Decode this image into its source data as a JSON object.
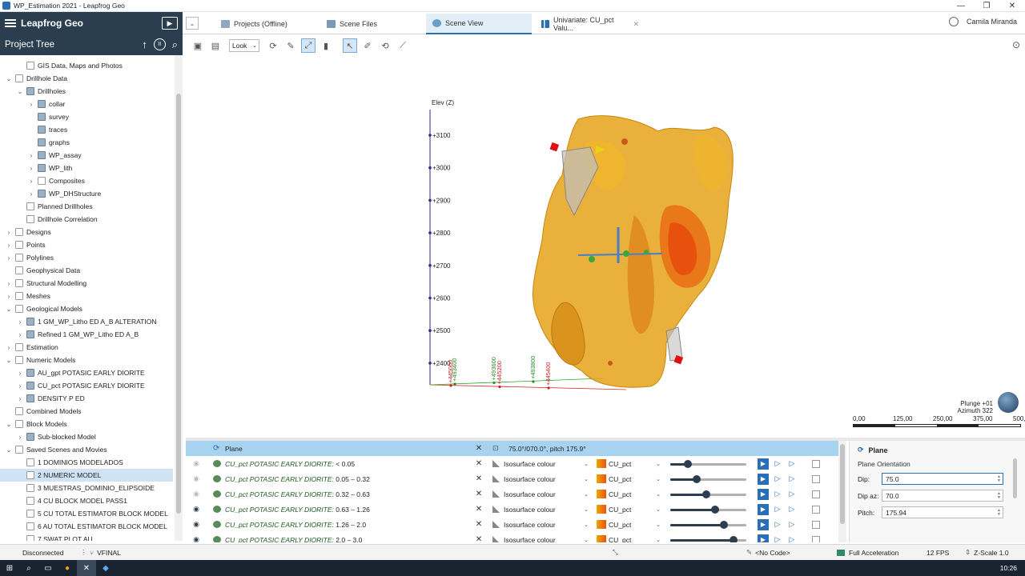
{
  "window": {
    "title": "WP_Estimation 2021 - Leapfrog Geo",
    "btn_min": "—",
    "btn_max": "❐",
    "btn_close": "✕"
  },
  "app": {
    "name": "Leapfrog Geo"
  },
  "tabs": [
    {
      "label": "Projects (Offline)"
    },
    {
      "label": "Scene Files"
    },
    {
      "label": "Scene View"
    },
    {
      "label": "Univariate: CU_pct Valu..."
    }
  ],
  "user": {
    "name": "Camila Miranda"
  },
  "project_tree": {
    "title": "Project Tree",
    "items": [
      {
        "label": "GIS Data, Maps and Photos"
      },
      {
        "label": "Drillhole Data"
      },
      {
        "label": "Drillholes"
      },
      {
        "label": "collar"
      },
      {
        "label": "survey"
      },
      {
        "label": "traces"
      },
      {
        "label": "graphs"
      },
      {
        "label": "WP_assay"
      },
      {
        "label": "WP_lith"
      },
      {
        "label": "Composites"
      },
      {
        "label": "WP_DHStructure"
      },
      {
        "label": "Planned Drillholes"
      },
      {
        "label": "Drillhole Correlation"
      },
      {
        "label": "Designs"
      },
      {
        "label": "Points"
      },
      {
        "label": "Polylines"
      },
      {
        "label": "Geophysical Data"
      },
      {
        "label": "Structural Modelling"
      },
      {
        "label": "Meshes"
      },
      {
        "label": "Geological Models"
      },
      {
        "label": "1 GM_WP_Litho ED A_B ALTERATION"
      },
      {
        "label": "Refined 1 GM_WP_Litho ED A_B"
      },
      {
        "label": "Estimation"
      },
      {
        "label": "Numeric Models"
      },
      {
        "label": "AU_gpt POTASIC EARLY DIORITE"
      },
      {
        "label": "CU_pct POTASIC EARLY DIORITE"
      },
      {
        "label": "DENSITY P ED"
      },
      {
        "label": "Combined Models"
      },
      {
        "label": "Block Models"
      },
      {
        "label": "Sub-blocked Model"
      },
      {
        "label": "Saved Scenes and Movies"
      },
      {
        "label": "1 DOMINIOS MODELADOS"
      },
      {
        "label": "2 NUMERIC MODEL"
      },
      {
        "label": "3 MUESTRAS_DOMINIO_ELIPSOIDE"
      },
      {
        "label": "4 CU BLOCK MODEL PASS1"
      },
      {
        "label": "5 CU TOTAL ESTIMATOR BLOCK MODEL"
      },
      {
        "label": "6 AU TOTAL ESTIMATOR BLOCK MODEL"
      },
      {
        "label": "7 SWAT PLOT AU"
      }
    ]
  },
  "toolbar": {
    "look_label": "Look"
  },
  "scene": {
    "elev_label": "Elev (Z)",
    "elev_ticks": [
      "+3100",
      "+3000",
      "+2900",
      "+2800",
      "+2700",
      "+2600",
      "+2500",
      "+2400"
    ],
    "north_ticks": [
      "+493400",
      "+493600",
      "+493800"
    ],
    "east_ticks": [
      "+445000",
      "+445200",
      "+445400"
    ],
    "plunge": "Plunge +01",
    "azimuth": "Azimuth 322",
    "scale_labels": [
      "0,00",
      "125,00",
      "250,00",
      "375,00",
      "500,00"
    ]
  },
  "layers": {
    "header": {
      "name": "Plane",
      "value": "75.0°/070.0°, pitch 175.9°"
    },
    "rows": [
      {
        "name": "CU_pct POTASIC EARLY DIORITE:",
        "range": "< 0.05",
        "mode": "Isosurface colour",
        "attr": "CU_pct",
        "visible": false,
        "opacity": 0.2
      },
      {
        "name": "CU_pct POTASIC EARLY DIORITE:",
        "range": "0.05 – 0.32",
        "mode": "Isosurface colour",
        "attr": "CU_pct",
        "visible": false,
        "opacity": 0.33
      },
      {
        "name": "CU_pct POTASIC EARLY DIORITE:",
        "range": "0.32 – 0.63",
        "mode": "Isosurface colour",
        "attr": "CU_pct",
        "visible": false,
        "opacity": 0.47
      },
      {
        "name": "CU_pct POTASIC EARLY DIORITE:",
        "range": "0.63 – 1.26",
        "mode": "Isosurface colour",
        "attr": "CU_pct",
        "visible": true,
        "opacity": 0.6
      },
      {
        "name": "CU_pct POTASIC EARLY DIORITE:",
        "range": "1.26 – 2.0",
        "mode": "Isosurface colour",
        "attr": "CU_pct",
        "visible": true,
        "opacity": 0.73
      },
      {
        "name": "CU_pct POTASIC EARLY DIORITE:",
        "range": "2.0 – 3.0",
        "mode": "Isosurface colour",
        "attr": "CU_pct",
        "visible": true,
        "opacity": 0.87
      }
    ]
  },
  "properties": {
    "title": "Plane",
    "section": "Plane Orientation",
    "dip_label": "Dip:",
    "dip_value": "75.0",
    "dipaz_label": "Dip az:",
    "dipaz_value": "70.0",
    "pitch_label": "Pitch:",
    "pitch_value": "175.94"
  },
  "status": {
    "connection": "Disconnected",
    "branch": "VFINAL",
    "code": "<No Code>",
    "accel": "Full Acceleration",
    "fps": "12 FPS",
    "zscale": "Z-Scale 1.0"
  },
  "taskbar": {
    "time": "10:26"
  },
  "colors": {
    "brand": "#2b3e50",
    "accent": "#2a6fb5",
    "ore": "#e8a317"
  }
}
